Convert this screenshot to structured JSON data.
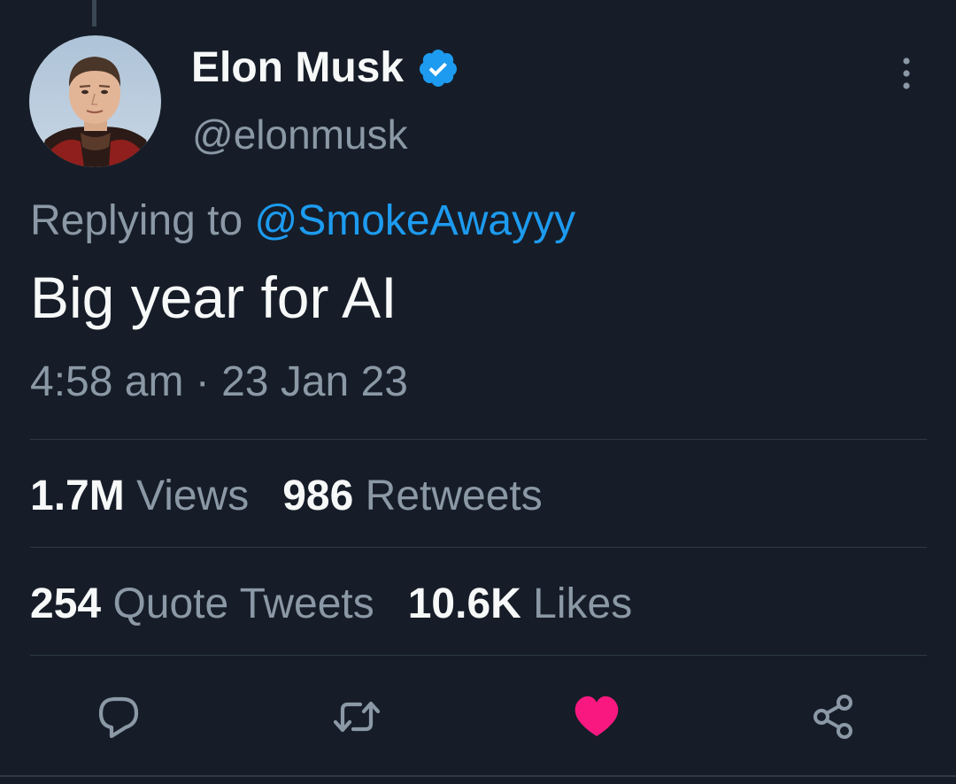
{
  "tweet": {
    "author_name": "Elon Musk",
    "author_handle": "@elonmusk",
    "avatar_icon": "avatar-photo",
    "verified_icon": "verified-badge-icon",
    "more_icon": "more-vertical-icon",
    "reply_prefix": "Replying to",
    "reply_to_handle": "@SmokeAwayyy",
    "text": "Big year for AI",
    "time": "4:58 am",
    "separator": "·",
    "date": "23 Jan 23"
  },
  "stats": {
    "views_count": "1.7M",
    "views_label": "Views",
    "retweets_count": "986",
    "retweets_label": "Retweets",
    "quote_tweets_count": "254",
    "quote_tweets_label": "Quote Tweets",
    "likes_count": "10.6K",
    "likes_label": "Likes"
  },
  "actions": [
    {
      "icon": "reply-icon"
    },
    {
      "icon": "retweet-icon"
    },
    {
      "icon": "like-icon-filled"
    },
    {
      "icon": "share-icon"
    }
  ],
  "colors": {
    "background": "#161d28",
    "link": "#1d9bf0",
    "secondary_text": "#8b98a5",
    "like_active": "#f91880",
    "verified": "#1d9bf0"
  }
}
